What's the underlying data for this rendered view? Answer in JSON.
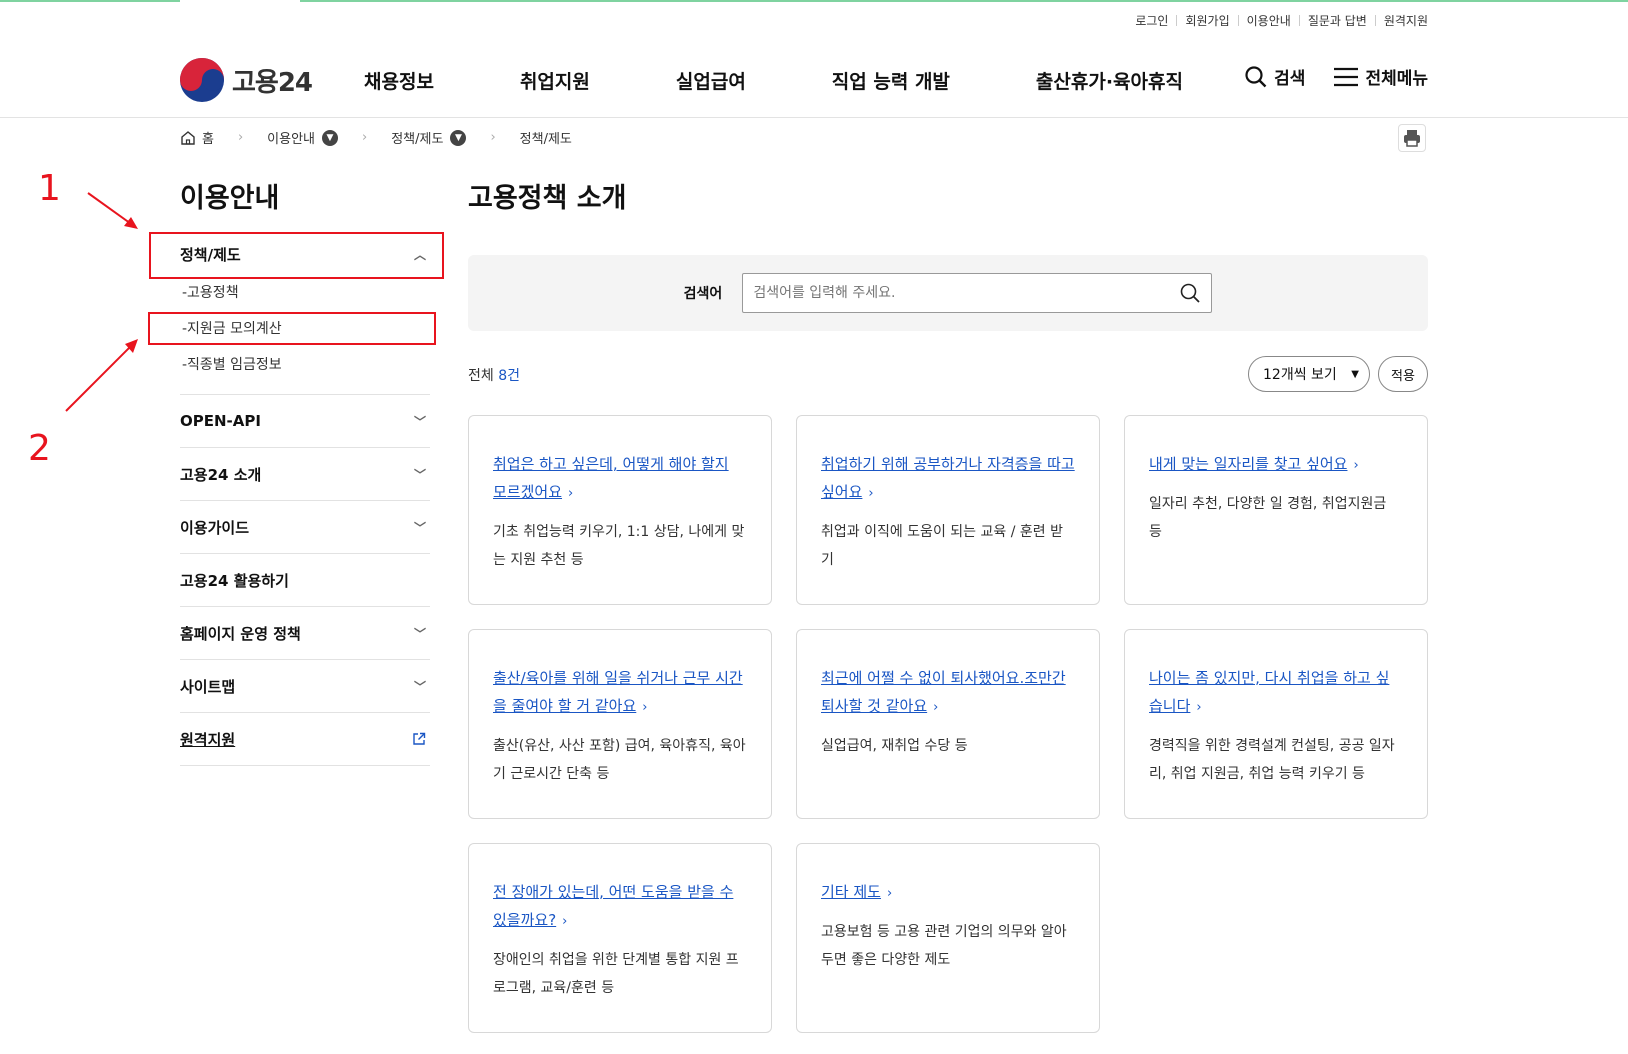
{
  "utility_links": [
    "로그인",
    "회원가입",
    "이용안내",
    "질문과 답변",
    "원격지원"
  ],
  "logo": {
    "text": "고용24"
  },
  "gnb": [
    "채용정보",
    "취업지원",
    "실업급여",
    "직업 능력 개발",
    "출산휴가·육아휴직"
  ],
  "header_actions": {
    "search": "검색",
    "menu": "전체메뉴"
  },
  "breadcrumb": {
    "home": "홈",
    "level1": "이용안내",
    "level2": "정책/제도",
    "current": "정책/제도"
  },
  "lnb": {
    "title": "이용안내",
    "group1": {
      "label": "정책/제도",
      "items": [
        "-고용정책",
        "-지원금 모의계산",
        "-직종별 임금정보"
      ]
    },
    "groups": [
      "OPEN-API",
      "고용24 소개",
      "이용가이드",
      "고용24 활용하기",
      "홈페이지 운영 정책",
      "사이트맵",
      "원격지원"
    ]
  },
  "annotations": {
    "num1": "1",
    "num2": "2",
    "color": "#e8141e"
  },
  "main": {
    "title": "고용정책 소개",
    "search": {
      "label": "검색어",
      "placeholder": "검색어를 입력해 주세요."
    },
    "count_prefix": "전체 ",
    "count_num": "8건",
    "page_size": "12개씩 보기",
    "apply": "적용",
    "cards": [
      {
        "title": "취업은 하고 싶은데, 어떻게 해야 할지 모르겠어요",
        "desc": "기초 취업능력 키우기, 1:1 상담, 나에게 맞는 지원 추천 등"
      },
      {
        "title": "취업하기 위해 공부하거나 자격증을 따고 싶어요",
        "desc": "취업과 이직에 도움이 되는 교육 / 훈련 받기"
      },
      {
        "title": "내게 맞는 일자리를 찾고 싶어요",
        "desc": "일자리 추천, 다양한 일 경험, 취업지원금 등"
      },
      {
        "title": "출산/육아를 위해 일을 쉬거나 근무 시간을 줄여야 할 거 같아요",
        "desc": "출산(유산, 사산 포함) 급여, 육아휴직, 육아기 근로시간 단축 등"
      },
      {
        "title": "최근에 어쩔 수 없이 퇴사했어요.조만간 퇴사할 것 같아요",
        "desc": "실업급여, 재취업 수당 등"
      },
      {
        "title": "나이는 좀 있지만, 다시 취업을 하고 싶습니다",
        "desc": "경력직을 위한 경력설계 컨설팅, 공공 일자리, 취업 지원금, 취업 능력 키우기 등"
      },
      {
        "title": "전 장애가 있는데, 어떤 도움을 받을 수 있을까요?",
        "desc": "장애인의 취업을 위한 단계별 통합 지원 프로그램, 교육/훈련 등"
      },
      {
        "title": "기타 제도",
        "desc": "고용보험 등 고용 관련 기업의 의무와 알아두면 좋은 다양한 제도"
      }
    ]
  },
  "colors": {
    "link": "#1a56c4",
    "accent_line": "#7fd3a0"
  }
}
